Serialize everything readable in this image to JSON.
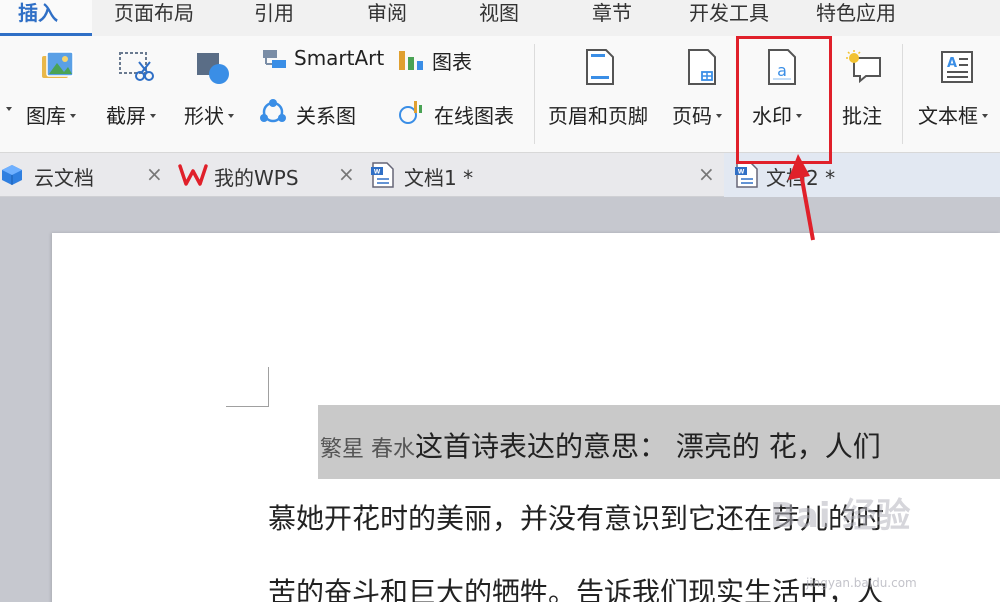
{
  "menu": {
    "tabs": [
      {
        "label": "插入",
        "active": true
      },
      {
        "label": "页面布局"
      },
      {
        "label": "引用"
      },
      {
        "label": "审阅"
      },
      {
        "label": "视图"
      },
      {
        "label": "章节"
      },
      {
        "label": "开发工具"
      },
      {
        "label": "特色应用"
      }
    ]
  },
  "ribbon": {
    "gallery": "图库",
    "screenshot": "截屏",
    "shapes": "形状",
    "smartart": "SmartArt",
    "chart": "图表",
    "relation": "关系图",
    "online_chart": "在线图表",
    "header_footer": "页眉和页脚",
    "page_number": "页码",
    "watermark": "水印",
    "comment": "批注",
    "textbox": "文本框"
  },
  "doc_tabs": [
    {
      "label": "云文档"
    },
    {
      "label": "我的WPS"
    },
    {
      "label": "文档1 *"
    },
    {
      "label": "文档2 *",
      "active": true
    }
  ],
  "document": {
    "line1_selected_prefix": "繁星 春水",
    "line1_rest": "这首诗表达的意思： 漂亮的 花，人们",
    "line2": "慕她开花时的美丽，并没有意识到它还在芽儿的时",
    "line3": "苦的奋斗和巨大的牺牲。告诉我们现实生活中，人"
  },
  "watermark_text": "Bai 经验",
  "watermark_url": "jingyan.baidu.com",
  "colors": {
    "accent": "#2f6fc6",
    "highlight": "#e0202a",
    "wps_red": "#e0202a"
  }
}
